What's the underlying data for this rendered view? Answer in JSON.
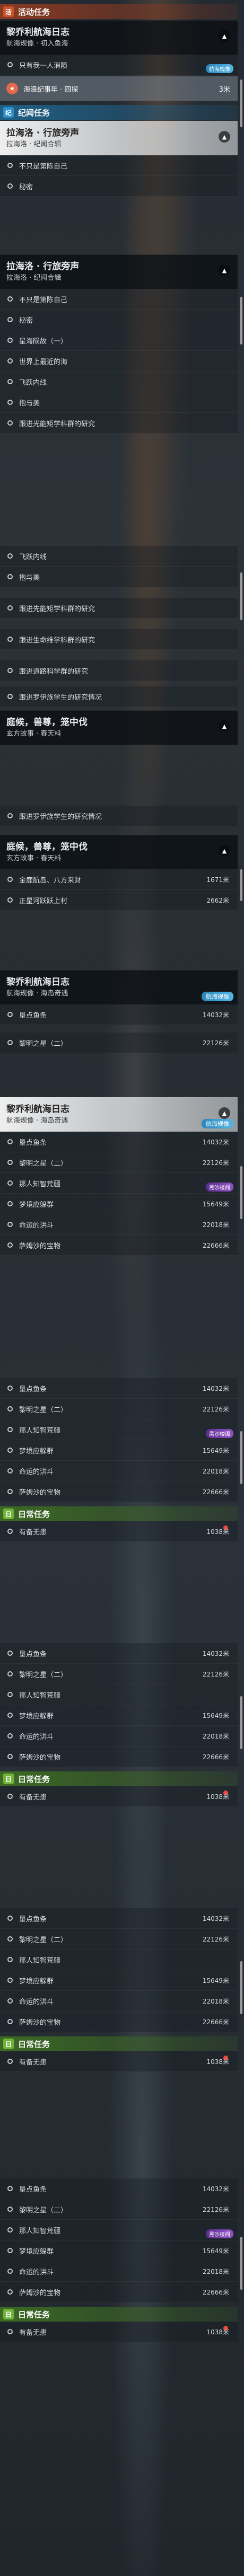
{
  "categories": {
    "activity": {
      "label": "活动任务",
      "icon": "活"
    },
    "story": {
      "label": "纪闻任务",
      "icon": "纪"
    },
    "daily": {
      "label": "日常任务",
      "icon": "日"
    }
  },
  "quests": {
    "zeliweinaite": {
      "title": "黎乔利航海日志",
      "subtitle": "航海规像 · 初入鱼海"
    },
    "kainaierduo": {
      "title": "拉海洛 · 行旅旁声",
      "subtitle": "拉海洛 · 纪闻合辑"
    },
    "tinghou": {
      "title": "庭候，兽尊，笼中伐",
      "subtitle": "玄方故事 · 春天料"
    },
    "zeli_map": {
      "title": "黎乔利航海日志",
      "subtitle": "航海规像 · 海岛奇遇"
    },
    "badge_blue": "航海规像",
    "badge_purple": "黑沙楼阁"
  },
  "objectives": {
    "only_one_word": "只有我一人消陨",
    "task_card": "海浪纪事年 · 四探",
    "task_card_dist": "3米",
    "not_only_sea": "不只是第陈自己",
    "secret": "秘密",
    "star_sea_1": "星海陨故（一）",
    "world_deep": "世界上最近的海",
    "fly_inside": "飞跃内线",
    "hug_me": "抱与美",
    "study_research": "跟进光能矩学科群的研究",
    "study_research_2": "跟进先能矩学科群的研究",
    "study_life": "跟进生命维学科群的研究",
    "study_road": "跟进道路科学群的研究",
    "study_galaxy": "跟进罗伊族学生的研究情况",
    "study_galaxy_2": "跟进罗伊族学生的研究情况",
    "gold_flow": "金鹿航岛、八方来财",
    "gold_flow_dist": "1671米",
    "king_river": "正星河跃跃上村",
    "king_river_dist": "2662米",
    "coastal_fish": "垦点鱼条",
    "coastal_fish_dist": "14032米",
    "dawn_2": "黎明之星（二）",
    "dawn_2_dist": "22126米",
    "new_world": "那人知智荒疆",
    "dream_map": "梦境应躲群",
    "dream_map_dist": "15649米",
    "sea_flow": "命运的洪斗",
    "sea_flow_dist": "22018米",
    "treasure": "萨姆沙的宝物",
    "treasure_dist": "22666米",
    "daily_item": "有备无患",
    "daily_item_dist": "1038米"
  },
  "colors": {
    "activity": "#c6532c",
    "story": "#2c8dc9",
    "daily": "#6fb33a",
    "dot": "#e84c3d"
  }
}
